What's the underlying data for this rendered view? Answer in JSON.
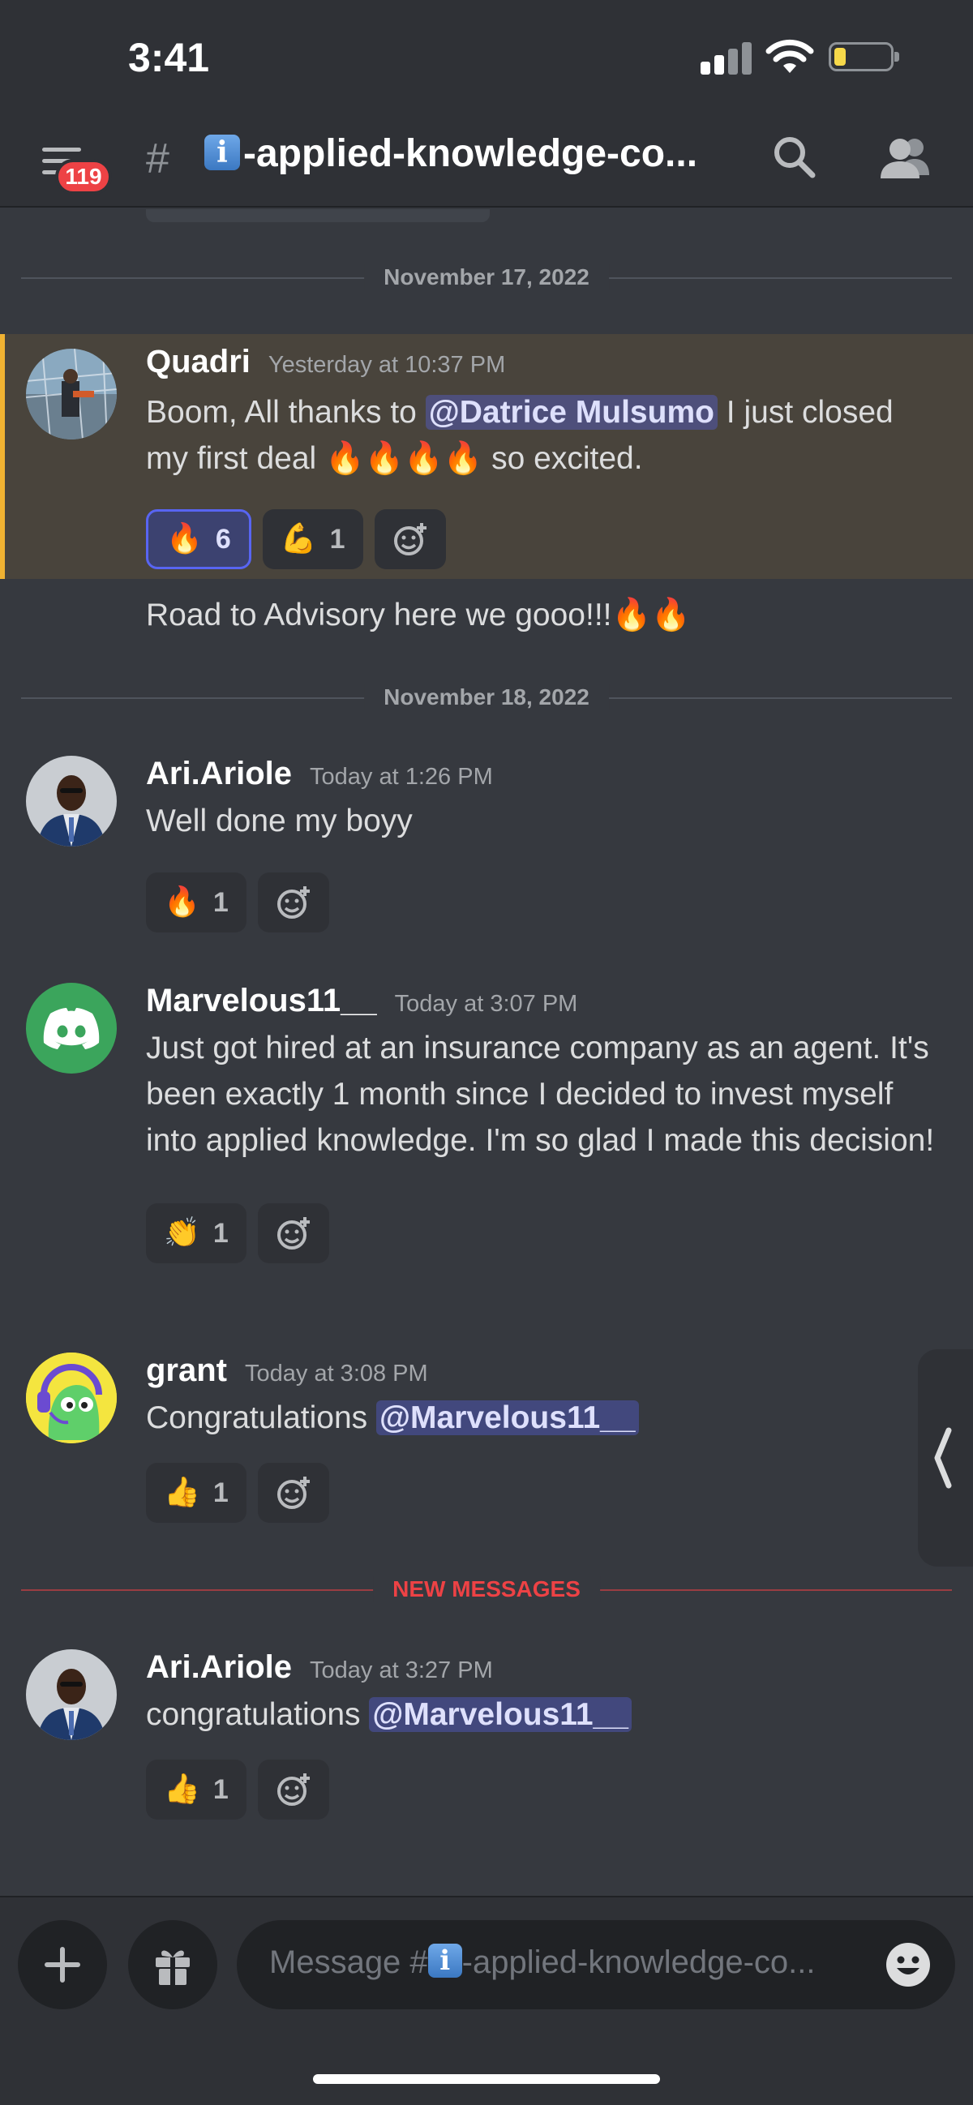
{
  "status_bar": {
    "time": "3:41"
  },
  "header": {
    "badge_count": "119",
    "hash": "#",
    "channel_emoji": "i",
    "channel_name": "-applied-knowledge-co..."
  },
  "dividers": {
    "date_1": "November 17, 2022",
    "date_2": "November 18, 2022",
    "new_messages": "NEW MESSAGES"
  },
  "messages": [
    {
      "username": "Quadri",
      "timestamp": "Yesterday at 10:37 PM",
      "text_before": "Boom, All thanks to ",
      "mention": "@Datrice Mulsumo",
      "text_after": " I just closed my first deal 🔥🔥🔥🔥 so excited.",
      "reactions": [
        {
          "emoji": "🔥",
          "count": "6"
        },
        {
          "emoji": "💪",
          "count": "1"
        }
      ],
      "followup": "Road to Advisory here we gooo!!!🔥🔥"
    },
    {
      "username": "Ari.Ariole",
      "timestamp": "Today at 1:26 PM",
      "text": "Well done my boyy",
      "reactions": [
        {
          "emoji": "🔥",
          "count": "1"
        }
      ]
    },
    {
      "username": "Marvelous11__",
      "timestamp": "Today at 3:07 PM",
      "text": "Just got hired at an insurance company as an agent. It's been exactly 1 month since I decided to invest myself into applied knowledge. I'm so glad I made this decision!",
      "reactions": [
        {
          "emoji": "👏",
          "count": "1"
        }
      ]
    },
    {
      "username": "grant",
      "timestamp": "Today at 3:08 PM",
      "text_before": "Congratulations ",
      "mention": "@Marvelous11__",
      "reactions": [
        {
          "emoji": "👍",
          "count": "1"
        }
      ]
    },
    {
      "username": "Ari.Ariole",
      "timestamp": "Today at 3:27 PM",
      "text_before": "congratulations ",
      "mention": "@Marvelous11__",
      "reactions": [
        {
          "emoji": "👍",
          "count": "1"
        }
      ]
    }
  ],
  "composer": {
    "placeholder_prefix": "Message #",
    "placeholder_emoji": "i",
    "placeholder_suffix": "-applied-knowledge-co..."
  },
  "icons": {
    "menu": "hamburger-icon",
    "search": "search-icon",
    "members": "members-icon",
    "add": "plus-icon",
    "gift": "gift-icon",
    "emoji": "smiley-icon",
    "add_reaction": "add-reaction-icon",
    "side_panel": "chevron-left-icon"
  },
  "colors": {
    "background": "#36393f",
    "header": "#2f3136",
    "blurple": "#5865f2",
    "mention_highlight": "#f0b232",
    "new_messages": "#ed4245",
    "discord_green": "#3ba55c"
  }
}
